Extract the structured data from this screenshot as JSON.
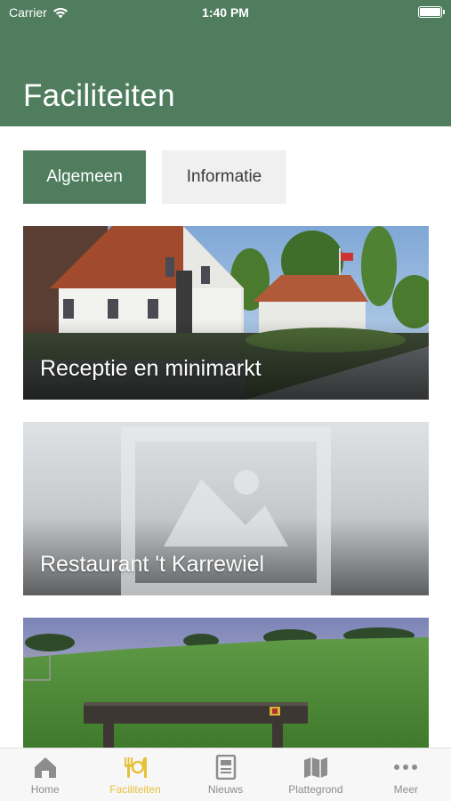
{
  "status_bar": {
    "carrier": "Carrier",
    "time": "1:40 PM"
  },
  "header": {
    "title": "Faciliteiten",
    "background_color": "#4f7d5e"
  },
  "tabs": [
    {
      "label": "Algemeen",
      "selected": true
    },
    {
      "label": "Informatie",
      "selected": false
    }
  ],
  "cards": [
    {
      "label": "Receptie en minimarkt",
      "image": "reception-building-photo"
    },
    {
      "label": "Restaurant 't Karrewiel",
      "image": "placeholder-image-icon"
    },
    {
      "label": "",
      "image": "grass-field-bench-photo"
    }
  ],
  "tab_bar": {
    "items": [
      {
        "label": "Home",
        "icon": "home-icon",
        "selected": false
      },
      {
        "label": "Faciliteiten",
        "icon": "cutlery-icon",
        "selected": true
      },
      {
        "label": "Nieuws",
        "icon": "newspaper-icon",
        "selected": false
      },
      {
        "label": "Plattegrond",
        "icon": "map-icon",
        "selected": false
      },
      {
        "label": "Meer",
        "icon": "more-icon",
        "selected": false
      }
    ],
    "selected_color": "#e6c13a",
    "inactive_color": "#8d8d8d"
  }
}
